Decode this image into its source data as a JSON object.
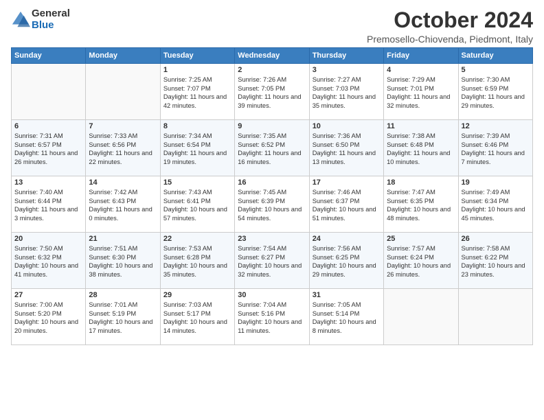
{
  "logo": {
    "general": "General",
    "blue": "Blue"
  },
  "title": "October 2024",
  "location": "Premosello-Chiovenda, Piedmont, Italy",
  "headers": [
    "Sunday",
    "Monday",
    "Tuesday",
    "Wednesday",
    "Thursday",
    "Friday",
    "Saturday"
  ],
  "weeks": [
    [
      {
        "day": "",
        "sunrise": "",
        "sunset": "",
        "daylight": ""
      },
      {
        "day": "",
        "sunrise": "",
        "sunset": "",
        "daylight": ""
      },
      {
        "day": "1",
        "sunrise": "Sunrise: 7:25 AM",
        "sunset": "Sunset: 7:07 PM",
        "daylight": "Daylight: 11 hours and 42 minutes."
      },
      {
        "day": "2",
        "sunrise": "Sunrise: 7:26 AM",
        "sunset": "Sunset: 7:05 PM",
        "daylight": "Daylight: 11 hours and 39 minutes."
      },
      {
        "day": "3",
        "sunrise": "Sunrise: 7:27 AM",
        "sunset": "Sunset: 7:03 PM",
        "daylight": "Daylight: 11 hours and 35 minutes."
      },
      {
        "day": "4",
        "sunrise": "Sunrise: 7:29 AM",
        "sunset": "Sunset: 7:01 PM",
        "daylight": "Daylight: 11 hours and 32 minutes."
      },
      {
        "day": "5",
        "sunrise": "Sunrise: 7:30 AM",
        "sunset": "Sunset: 6:59 PM",
        "daylight": "Daylight: 11 hours and 29 minutes."
      }
    ],
    [
      {
        "day": "6",
        "sunrise": "Sunrise: 7:31 AM",
        "sunset": "Sunset: 6:57 PM",
        "daylight": "Daylight: 11 hours and 26 minutes."
      },
      {
        "day": "7",
        "sunrise": "Sunrise: 7:33 AM",
        "sunset": "Sunset: 6:56 PM",
        "daylight": "Daylight: 11 hours and 22 minutes."
      },
      {
        "day": "8",
        "sunrise": "Sunrise: 7:34 AM",
        "sunset": "Sunset: 6:54 PM",
        "daylight": "Daylight: 11 hours and 19 minutes."
      },
      {
        "day": "9",
        "sunrise": "Sunrise: 7:35 AM",
        "sunset": "Sunset: 6:52 PM",
        "daylight": "Daylight: 11 hours and 16 minutes."
      },
      {
        "day": "10",
        "sunrise": "Sunrise: 7:36 AM",
        "sunset": "Sunset: 6:50 PM",
        "daylight": "Daylight: 11 hours and 13 minutes."
      },
      {
        "day": "11",
        "sunrise": "Sunrise: 7:38 AM",
        "sunset": "Sunset: 6:48 PM",
        "daylight": "Daylight: 11 hours and 10 minutes."
      },
      {
        "day": "12",
        "sunrise": "Sunrise: 7:39 AM",
        "sunset": "Sunset: 6:46 PM",
        "daylight": "Daylight: 11 hours and 7 minutes."
      }
    ],
    [
      {
        "day": "13",
        "sunrise": "Sunrise: 7:40 AM",
        "sunset": "Sunset: 6:44 PM",
        "daylight": "Daylight: 11 hours and 3 minutes."
      },
      {
        "day": "14",
        "sunrise": "Sunrise: 7:42 AM",
        "sunset": "Sunset: 6:43 PM",
        "daylight": "Daylight: 11 hours and 0 minutes."
      },
      {
        "day": "15",
        "sunrise": "Sunrise: 7:43 AM",
        "sunset": "Sunset: 6:41 PM",
        "daylight": "Daylight: 10 hours and 57 minutes."
      },
      {
        "day": "16",
        "sunrise": "Sunrise: 7:45 AM",
        "sunset": "Sunset: 6:39 PM",
        "daylight": "Daylight: 10 hours and 54 minutes."
      },
      {
        "day": "17",
        "sunrise": "Sunrise: 7:46 AM",
        "sunset": "Sunset: 6:37 PM",
        "daylight": "Daylight: 10 hours and 51 minutes."
      },
      {
        "day": "18",
        "sunrise": "Sunrise: 7:47 AM",
        "sunset": "Sunset: 6:35 PM",
        "daylight": "Daylight: 10 hours and 48 minutes."
      },
      {
        "day": "19",
        "sunrise": "Sunrise: 7:49 AM",
        "sunset": "Sunset: 6:34 PM",
        "daylight": "Daylight: 10 hours and 45 minutes."
      }
    ],
    [
      {
        "day": "20",
        "sunrise": "Sunrise: 7:50 AM",
        "sunset": "Sunset: 6:32 PM",
        "daylight": "Daylight: 10 hours and 41 minutes."
      },
      {
        "day": "21",
        "sunrise": "Sunrise: 7:51 AM",
        "sunset": "Sunset: 6:30 PM",
        "daylight": "Daylight: 10 hours and 38 minutes."
      },
      {
        "day": "22",
        "sunrise": "Sunrise: 7:53 AM",
        "sunset": "Sunset: 6:28 PM",
        "daylight": "Daylight: 10 hours and 35 minutes."
      },
      {
        "day": "23",
        "sunrise": "Sunrise: 7:54 AM",
        "sunset": "Sunset: 6:27 PM",
        "daylight": "Daylight: 10 hours and 32 minutes."
      },
      {
        "day": "24",
        "sunrise": "Sunrise: 7:56 AM",
        "sunset": "Sunset: 6:25 PM",
        "daylight": "Daylight: 10 hours and 29 minutes."
      },
      {
        "day": "25",
        "sunrise": "Sunrise: 7:57 AM",
        "sunset": "Sunset: 6:24 PM",
        "daylight": "Daylight: 10 hours and 26 minutes."
      },
      {
        "day": "26",
        "sunrise": "Sunrise: 7:58 AM",
        "sunset": "Sunset: 6:22 PM",
        "daylight": "Daylight: 10 hours and 23 minutes."
      }
    ],
    [
      {
        "day": "27",
        "sunrise": "Sunrise: 7:00 AM",
        "sunset": "Sunset: 5:20 PM",
        "daylight": "Daylight: 10 hours and 20 minutes."
      },
      {
        "day": "28",
        "sunrise": "Sunrise: 7:01 AM",
        "sunset": "Sunset: 5:19 PM",
        "daylight": "Daylight: 10 hours and 17 minutes."
      },
      {
        "day": "29",
        "sunrise": "Sunrise: 7:03 AM",
        "sunset": "Sunset: 5:17 PM",
        "daylight": "Daylight: 10 hours and 14 minutes."
      },
      {
        "day": "30",
        "sunrise": "Sunrise: 7:04 AM",
        "sunset": "Sunset: 5:16 PM",
        "daylight": "Daylight: 10 hours and 11 minutes."
      },
      {
        "day": "31",
        "sunrise": "Sunrise: 7:05 AM",
        "sunset": "Sunset: 5:14 PM",
        "daylight": "Daylight: 10 hours and 8 minutes."
      },
      {
        "day": "",
        "sunrise": "",
        "sunset": "",
        "daylight": ""
      },
      {
        "day": "",
        "sunrise": "",
        "sunset": "",
        "daylight": ""
      }
    ]
  ]
}
